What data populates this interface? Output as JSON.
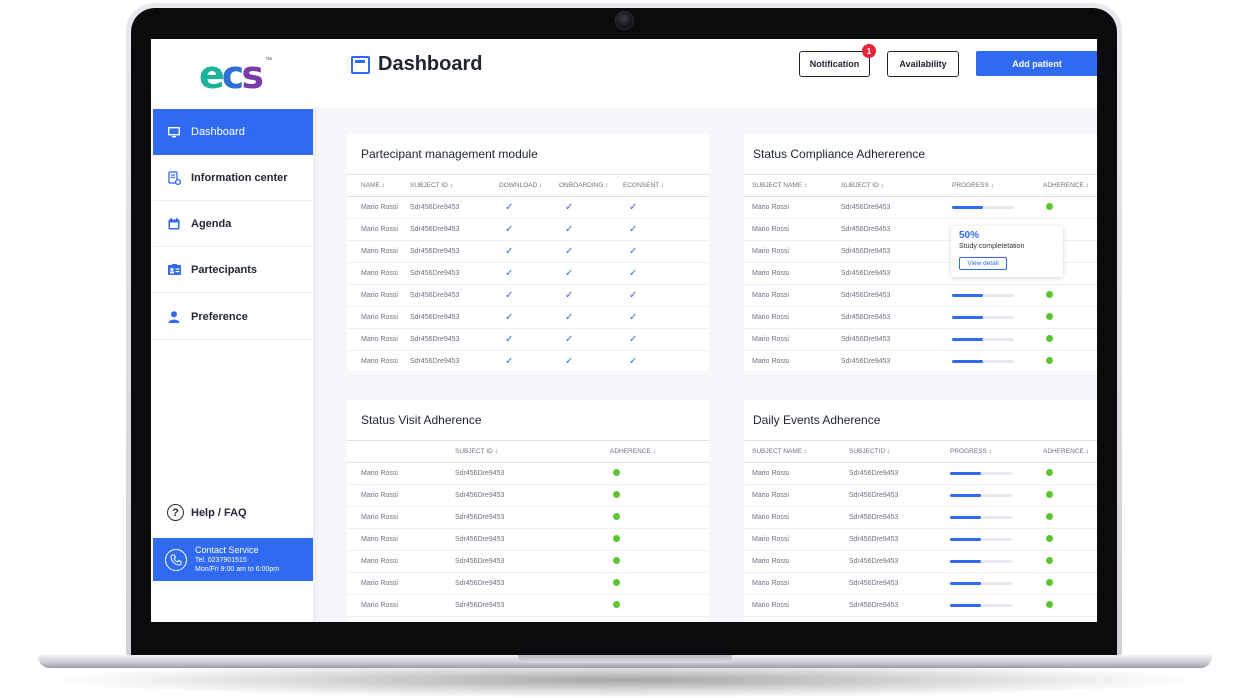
{
  "app": {
    "logo_text": "ecs",
    "logo_tm": "™"
  },
  "sidebar": {
    "items": [
      {
        "label": "Dashboard",
        "icon": "monitor-icon",
        "active": true
      },
      {
        "label": "Information center",
        "icon": "info-gear-icon",
        "active": false
      },
      {
        "label": "Agenda",
        "icon": "calendar-icon",
        "active": false
      },
      {
        "label": "Partecipants",
        "icon": "id-card-icon",
        "active": false
      },
      {
        "label": "Preference",
        "icon": "person-icon",
        "active": false
      }
    ],
    "help_label": "Help / FAQ",
    "contact": {
      "title": "Contact Service",
      "phone": "Tel. 0237901515",
      "hours": "Mon/Fri 9:00 am to 6:00pm"
    }
  },
  "header": {
    "title": "Dashboard",
    "notification_label": "Notification",
    "notification_count": "1",
    "availability_label": "Availability",
    "add_patient_label": "Add patient"
  },
  "participant_module": {
    "title": "Partecipant management module",
    "columns": [
      "NAME ↕",
      "SUBJECT ID ↕",
      "DOWNLOAD ↕",
      "ONBOARDING ↕",
      "ECONSENT ↕"
    ],
    "rows": [
      {
        "name": "Mario Rossi",
        "subject_id": "Sdr456Dre9453",
        "download": "✓",
        "onboarding": "✓",
        "econsent": "✓"
      },
      {
        "name": "Mario Rossi",
        "subject_id": "Sdr456Dre9453",
        "download": "✓",
        "onboarding": "✓",
        "econsent": "✓"
      },
      {
        "name": "Mario Rossi",
        "subject_id": "Sdr456Dre9453",
        "download": "✓",
        "onboarding": "✓",
        "econsent": "✓"
      },
      {
        "name": "Mario Rossi",
        "subject_id": "Sdr456Dre9453",
        "download": "✓",
        "onboarding": "✓",
        "econsent": "✓"
      },
      {
        "name": "Mario Rossi",
        "subject_id": "Sdr456Dre9453",
        "download": "✓",
        "onboarding": "✓",
        "econsent": "✓"
      },
      {
        "name": "Mario Rossi",
        "subject_id": "Sdr456Dre9453",
        "download": "✓",
        "onboarding": "✓",
        "econsent": "✓"
      },
      {
        "name": "Mario Rossi",
        "subject_id": "Sdr456Dre9453",
        "download": "✓",
        "onboarding": "✓",
        "econsent": "✓"
      },
      {
        "name": "Mario Rossi",
        "subject_id": "Sdr456Dre9453",
        "download": "✓",
        "onboarding": "✓",
        "econsent": "✓"
      }
    ]
  },
  "compliance": {
    "title": "Status Compliance Adhererence",
    "columns": [
      "SUBJECT NAME ↕",
      "SUBJECT ID ↕",
      "PROGRESS ↕",
      "ADHERENCE ↕"
    ],
    "rows": [
      {
        "name": "Mario Rossi",
        "subject_id": "Sdr456Dre9453",
        "progress": 0.5,
        "adherence": true
      },
      {
        "name": "Mario Rossi",
        "subject_id": "Sdr456Dre9453",
        "progress": 0.5,
        "adherence": false
      },
      {
        "name": "Mario Rossi",
        "subject_id": "Sdr456Dre9453",
        "progress": 0.5,
        "adherence": false
      },
      {
        "name": "Mario Rossi",
        "subject_id": "Sdr456Dre9453",
        "progress": 0.5,
        "adherence": false
      },
      {
        "name": "Mario Rossi",
        "subject_id": "Sdr456Dre9453",
        "progress": 0.5,
        "adherence": true
      },
      {
        "name": "Mario Rossi",
        "subject_id": "Sdr456Dre9453",
        "progress": 0.5,
        "adherence": true
      },
      {
        "name": "Mario Rossi",
        "subject_id": "Sdr456Dre9453",
        "progress": 0.5,
        "adherence": true
      },
      {
        "name": "Mario Rossi",
        "subject_id": "Sdr456Dre9453",
        "progress": 0.5,
        "adherence": true
      }
    ],
    "tooltip": {
      "percent": "50%",
      "label": "Study completetation",
      "button": "View detail"
    }
  },
  "visit": {
    "title": "Status Visit Adherence",
    "columns": [
      "",
      "SUBJECT ID ↕",
      "ADHERENCE ↕"
    ],
    "rows": [
      {
        "name": "Mario Rossi",
        "subject_id": "Sdr456Dre9453",
        "adherence": true
      },
      {
        "name": "Mario Rossi",
        "subject_id": "Sdr456Dre9453",
        "adherence": true
      },
      {
        "name": "Mario Rossi",
        "subject_id": "Sdr456Dre9453",
        "adherence": true
      },
      {
        "name": "Mario Rossi",
        "subject_id": "Sdr456Dre9453",
        "adherence": true
      },
      {
        "name": "Mario Rossi",
        "subject_id": "Sdr456Dre9453",
        "adherence": true
      },
      {
        "name": "Mario Rossi",
        "subject_id": "Sdr456Dre9453",
        "adherence": true
      },
      {
        "name": "Mario Rossi",
        "subject_id": "Sdr456Dre9453",
        "adherence": true
      }
    ]
  },
  "daily": {
    "title": "Daily Events Adherence",
    "columns": [
      "SUBJECT NAME ↕",
      "SUBJECTID ↕",
      "PROGRESS ↕",
      "ADHERENCE ↕"
    ],
    "rows": [
      {
        "name": "Mario Rossi",
        "subject_id": "Sdr456Dre9453",
        "progress": 0.5,
        "adherence": true
      },
      {
        "name": "Mario Rossi",
        "subject_id": "Sdr456Dre9453",
        "progress": 0.5,
        "adherence": true
      },
      {
        "name": "Mario Rossi",
        "subject_id": "Sdr456Dre9453",
        "progress": 0.5,
        "adherence": true
      },
      {
        "name": "Mario Rossi",
        "subject_id": "Sdr456Dre9453",
        "progress": 0.5,
        "adherence": true
      },
      {
        "name": "Mario Rossi",
        "subject_id": "Sdr456Dre9453",
        "progress": 0.5,
        "adherence": true
      },
      {
        "name": "Mario Rossi",
        "subject_id": "Sdr456Dre9453",
        "progress": 0.5,
        "adherence": true
      },
      {
        "name": "Mario Rossi",
        "subject_id": "Sdr456Dre9453",
        "progress": 0.5,
        "adherence": true
      }
    ]
  },
  "colors": {
    "primary": "#2f6af0",
    "adherence_ok": "#5cc630",
    "badge": "#e8233a"
  }
}
